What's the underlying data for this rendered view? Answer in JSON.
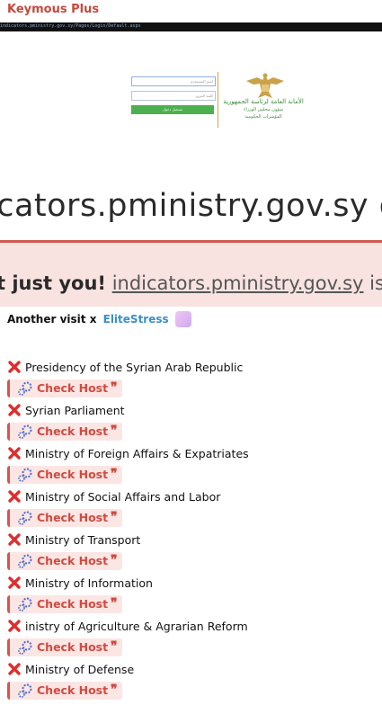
{
  "header": {
    "channel_name": "Keymous Plus"
  },
  "preview": {
    "url": "indicators.pministry.gov.sy/Pages/Login/Default.aspx",
    "login": {
      "username_placeholder": "اسم المستخدم",
      "password_placeholder": "كلمة المرور",
      "login_button": "تسجيل دخول"
    },
    "org": {
      "title": "الأمانة العامة لرئاسة الجمهورية",
      "subtitle_1": "شؤون مجلس الوزراء",
      "subtitle_2": "المؤشرات الحكومية"
    },
    "big_domain": "icators.pministry.gov.sy d",
    "down": {
      "part1": "t just you!",
      "link": "indicators.pministry.gov.sy",
      "part2": "is down"
    }
  },
  "message": {
    "another_visit": "Another visit x",
    "handle": "EliteStress"
  },
  "entries": [
    {
      "title": "Presidency of the Syrian Arab Republic",
      "button": "Check Host"
    },
    {
      "title": "Syrian Parliament",
      "button": "Check Host"
    },
    {
      "title": "Ministry of Foreign Affairs & Expatriates",
      "button": "Check Host"
    },
    {
      "title": "Ministry of Social Affairs and Labor",
      "button": "Check Host"
    },
    {
      "title": "Ministry of Transport",
      "button": "Check Host"
    },
    {
      "title": "Ministry of Information",
      "button": "Check Host"
    },
    {
      "title": "inistry of Agriculture & Agrarian Reform",
      "button": "Check Host"
    },
    {
      "title": "Ministry of Defense",
      "button": "Check Host"
    }
  ],
  "icons": {
    "status": "cross-mark-icon",
    "button": "gear-icon",
    "quote": "quote-icon"
  },
  "colors": {
    "brand_red": "#d24a40",
    "link_blue": "#3a8fc6",
    "pill_bg": "#fbe6e4"
  }
}
